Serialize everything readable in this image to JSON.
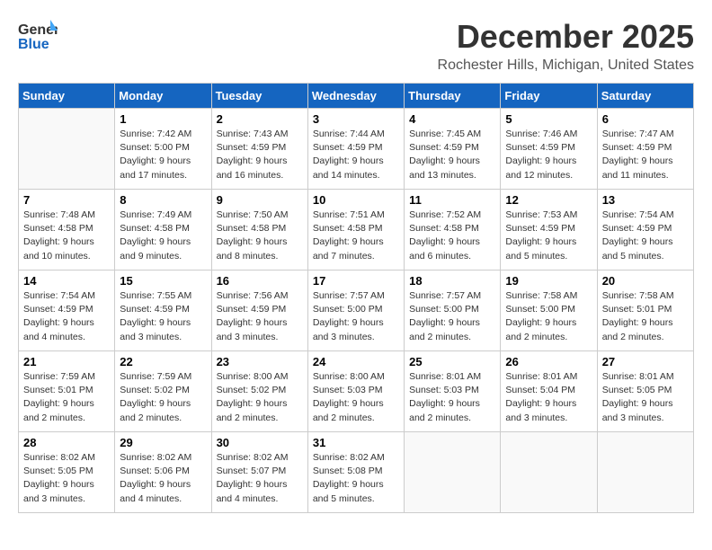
{
  "header": {
    "logo_general": "General",
    "logo_blue": "Blue",
    "month_title": "December 2025",
    "location": "Rochester Hills, Michigan, United States"
  },
  "days_of_week": [
    "Sunday",
    "Monday",
    "Tuesday",
    "Wednesday",
    "Thursday",
    "Friday",
    "Saturday"
  ],
  "weeks": [
    [
      {
        "day": "",
        "info": ""
      },
      {
        "day": "1",
        "info": "Sunrise: 7:42 AM\nSunset: 5:00 PM\nDaylight: 9 hours\nand 17 minutes."
      },
      {
        "day": "2",
        "info": "Sunrise: 7:43 AM\nSunset: 4:59 PM\nDaylight: 9 hours\nand 16 minutes."
      },
      {
        "day": "3",
        "info": "Sunrise: 7:44 AM\nSunset: 4:59 PM\nDaylight: 9 hours\nand 14 minutes."
      },
      {
        "day": "4",
        "info": "Sunrise: 7:45 AM\nSunset: 4:59 PM\nDaylight: 9 hours\nand 13 minutes."
      },
      {
        "day": "5",
        "info": "Sunrise: 7:46 AM\nSunset: 4:59 PM\nDaylight: 9 hours\nand 12 minutes."
      },
      {
        "day": "6",
        "info": "Sunrise: 7:47 AM\nSunset: 4:59 PM\nDaylight: 9 hours\nand 11 minutes."
      }
    ],
    [
      {
        "day": "7",
        "info": "Sunrise: 7:48 AM\nSunset: 4:58 PM\nDaylight: 9 hours\nand 10 minutes."
      },
      {
        "day": "8",
        "info": "Sunrise: 7:49 AM\nSunset: 4:58 PM\nDaylight: 9 hours\nand 9 minutes."
      },
      {
        "day": "9",
        "info": "Sunrise: 7:50 AM\nSunset: 4:58 PM\nDaylight: 9 hours\nand 8 minutes."
      },
      {
        "day": "10",
        "info": "Sunrise: 7:51 AM\nSunset: 4:58 PM\nDaylight: 9 hours\nand 7 minutes."
      },
      {
        "day": "11",
        "info": "Sunrise: 7:52 AM\nSunset: 4:58 PM\nDaylight: 9 hours\nand 6 minutes."
      },
      {
        "day": "12",
        "info": "Sunrise: 7:53 AM\nSunset: 4:59 PM\nDaylight: 9 hours\nand 5 minutes."
      },
      {
        "day": "13",
        "info": "Sunrise: 7:54 AM\nSunset: 4:59 PM\nDaylight: 9 hours\nand 5 minutes."
      }
    ],
    [
      {
        "day": "14",
        "info": "Sunrise: 7:54 AM\nSunset: 4:59 PM\nDaylight: 9 hours\nand 4 minutes."
      },
      {
        "day": "15",
        "info": "Sunrise: 7:55 AM\nSunset: 4:59 PM\nDaylight: 9 hours\nand 3 minutes."
      },
      {
        "day": "16",
        "info": "Sunrise: 7:56 AM\nSunset: 4:59 PM\nDaylight: 9 hours\nand 3 minutes."
      },
      {
        "day": "17",
        "info": "Sunrise: 7:57 AM\nSunset: 5:00 PM\nDaylight: 9 hours\nand 3 minutes."
      },
      {
        "day": "18",
        "info": "Sunrise: 7:57 AM\nSunset: 5:00 PM\nDaylight: 9 hours\nand 2 minutes."
      },
      {
        "day": "19",
        "info": "Sunrise: 7:58 AM\nSunset: 5:00 PM\nDaylight: 9 hours\nand 2 minutes."
      },
      {
        "day": "20",
        "info": "Sunrise: 7:58 AM\nSunset: 5:01 PM\nDaylight: 9 hours\nand 2 minutes."
      }
    ],
    [
      {
        "day": "21",
        "info": "Sunrise: 7:59 AM\nSunset: 5:01 PM\nDaylight: 9 hours\nand 2 minutes."
      },
      {
        "day": "22",
        "info": "Sunrise: 7:59 AM\nSunset: 5:02 PM\nDaylight: 9 hours\nand 2 minutes."
      },
      {
        "day": "23",
        "info": "Sunrise: 8:00 AM\nSunset: 5:02 PM\nDaylight: 9 hours\nand 2 minutes."
      },
      {
        "day": "24",
        "info": "Sunrise: 8:00 AM\nSunset: 5:03 PM\nDaylight: 9 hours\nand 2 minutes."
      },
      {
        "day": "25",
        "info": "Sunrise: 8:01 AM\nSunset: 5:03 PM\nDaylight: 9 hours\nand 2 minutes."
      },
      {
        "day": "26",
        "info": "Sunrise: 8:01 AM\nSunset: 5:04 PM\nDaylight: 9 hours\nand 3 minutes."
      },
      {
        "day": "27",
        "info": "Sunrise: 8:01 AM\nSunset: 5:05 PM\nDaylight: 9 hours\nand 3 minutes."
      }
    ],
    [
      {
        "day": "28",
        "info": "Sunrise: 8:02 AM\nSunset: 5:05 PM\nDaylight: 9 hours\nand 3 minutes."
      },
      {
        "day": "29",
        "info": "Sunrise: 8:02 AM\nSunset: 5:06 PM\nDaylight: 9 hours\nand 4 minutes."
      },
      {
        "day": "30",
        "info": "Sunrise: 8:02 AM\nSunset: 5:07 PM\nDaylight: 9 hours\nand 4 minutes."
      },
      {
        "day": "31",
        "info": "Sunrise: 8:02 AM\nSunset: 5:08 PM\nDaylight: 9 hours\nand 5 minutes."
      },
      {
        "day": "",
        "info": ""
      },
      {
        "day": "",
        "info": ""
      },
      {
        "day": "",
        "info": ""
      }
    ]
  ]
}
